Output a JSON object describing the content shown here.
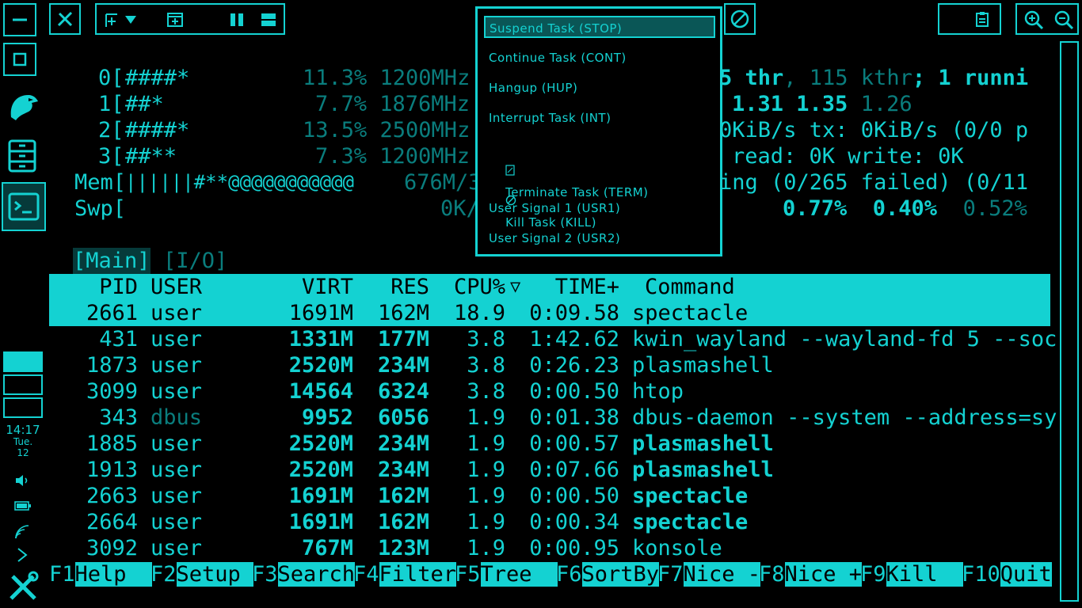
{
  "left_panel": {
    "clock": {
      "time": "14:17",
      "day": "Tue.",
      "date": "12"
    }
  },
  "meters": {
    "cpu0_id": "0[",
    "cpu0_bar": "####*",
    "cpu0_val": "11.3% 1200MHz",
    "cpu1_id": "1[",
    "cpu1_bar": "##*",
    "cpu1_val": "7.7% 1876MHz",
    "cpu2_id": "2[",
    "cpu2_bar": "####*",
    "cpu2_val": "13.5% 2500MHz",
    "cpu3_id": "3[",
    "cpu3_bar": "##**",
    "cpu3_val": "7.3% 1200MHz",
    "mem_label": "Mem[",
    "mem_bar": "||||||#**@@@@@@@@@@@",
    "mem_val": "676M/3",
    "swp_label": "Swp[",
    "swp_val": "0K/",
    "tasks_a": "5 thr",
    "tasks_b": ", 115 kthr",
    "tasks_c": "; 1 runni",
    "load_a": "1.31 1.35",
    "load_b": " 1.26",
    "net": "0KiB/s tx: 0KiB/s (0/0 p",
    "disk": "read: 0K write: 0K",
    "systemd": "ing (0/265 failed) (0/11",
    "psi_a": "0.77%  0.40%",
    "psi_b": "  0.52%"
  },
  "tabs": {
    "main": "[Main]",
    "io": "[I/O]"
  },
  "table": {
    "headers": {
      "pid": "PID",
      "user": "USER",
      "virt": "VIRT",
      "res": "RES",
      "cpu": "CPU%",
      "sort": "▽",
      "time": "TIME+",
      "command": "Command"
    },
    "rows": [
      {
        "pid": "2661",
        "user": "user",
        "virt": "1691M",
        "res": "162M",
        "cpu": "18.9",
        "time": "0:09.58",
        "cmd": "spectacle"
      },
      {
        "pid": "431",
        "user": "user",
        "virt": "1331M",
        "res": "177M",
        "cpu": "3.8",
        "time": "1:42.62",
        "cmd": "kwin_wayland --wayland-fd 5 --soc"
      },
      {
        "pid": "1873",
        "user": "user",
        "virt": "2520M",
        "res": "234M",
        "cpu": "3.8",
        "time": "0:26.23",
        "cmd": "plasmashell"
      },
      {
        "pid": "3099",
        "user": "user",
        "virt": "14564",
        "res": "6324",
        "cpu": "3.8",
        "time": "0:00.50",
        "cmd": "htop"
      },
      {
        "pid": "343",
        "user": "dbus",
        "virt": "9952",
        "res": "6056",
        "cpu": "1.9",
        "time": "0:01.38",
        "cmd": "dbus-daemon --system --address=sy"
      },
      {
        "pid": "1885",
        "user": "user",
        "virt": "2520M",
        "res": "234M",
        "cpu": "1.9",
        "time": "0:00.57",
        "cmd": "plasmashell"
      },
      {
        "pid": "1913",
        "user": "user",
        "virt": "2520M",
        "res": "234M",
        "cpu": "1.9",
        "time": "0:07.66",
        "cmd": "plasmashell"
      },
      {
        "pid": "2663",
        "user": "user",
        "virt": "1691M",
        "res": "162M",
        "cpu": "1.9",
        "time": "0:00.50",
        "cmd": "spectacle"
      },
      {
        "pid": "2664",
        "user": "user",
        "virt": "1691M",
        "res": "162M",
        "cpu": "1.9",
        "time": "0:00.34",
        "cmd": "spectacle"
      },
      {
        "pid": "3092",
        "user": "user",
        "virt": "767M",
        "res": "123M",
        "cpu": "1.9",
        "time": "0:00.95",
        "cmd": "konsole"
      }
    ]
  },
  "signal_menu": {
    "items": [
      "Suspend Task (STOP)",
      "Continue Task (CONT)",
      "Hangup (HUP)",
      "Interrupt Task (INT)",
      "Terminate Task (TERM)",
      "Kill Task (KILL)",
      "User Signal 1 (USR1)",
      "User Signal 2 (USR2)"
    ]
  },
  "function_keys": [
    {
      "key": "F1",
      "label": "Help  "
    },
    {
      "key": "F2",
      "label": "Setup "
    },
    {
      "key": "F3",
      "label": "Search"
    },
    {
      "key": "F4",
      "label": "Filter"
    },
    {
      "key": "F5",
      "label": "Tree  "
    },
    {
      "key": "F6",
      "label": "SortBy"
    },
    {
      "key": "F7",
      "label": "Nice -"
    },
    {
      "key": "F8",
      "label": "Nice +"
    },
    {
      "key": "F9",
      "label": "Kill  "
    },
    {
      "key": "F10",
      "label": "Quit"
    }
  ],
  "colors": {
    "accent": "#14d2d2",
    "dim": "#0a7d7d",
    "menu_selected_bg": "#0a5656",
    "background": "#000000"
  }
}
